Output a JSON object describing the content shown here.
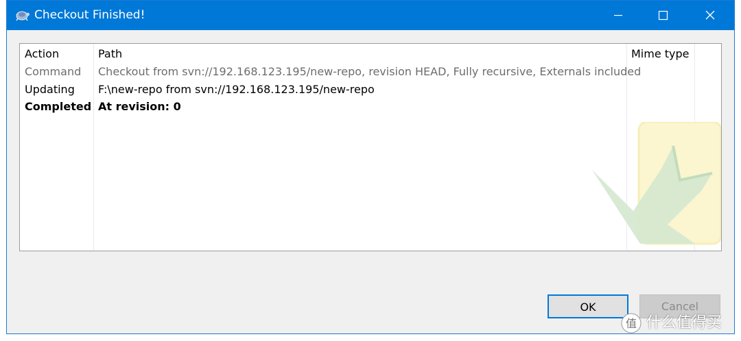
{
  "window": {
    "title": "Checkout Finished!",
    "title_icon": "tortoise-icon",
    "accent_color": "#0078d7"
  },
  "list": {
    "headers": [
      "Action",
      "Path",
      "Mime type"
    ],
    "rows": [
      {
        "action": "Command",
        "path": "Checkout from svn://192.168.123.195/new-repo, revision HEAD, Fully recursive, Externals included",
        "mime": ""
      },
      {
        "action": "Updating",
        "path": "F:\\new-repo from svn://192.168.123.195/new-repo",
        "mime": ""
      },
      {
        "action": "Completed",
        "path": "At revision: 0",
        "mime": ""
      }
    ]
  },
  "buttons": {
    "ok": "OK",
    "cancel": "Cancel"
  },
  "watermark": {
    "brand_text": "什么值得买"
  }
}
